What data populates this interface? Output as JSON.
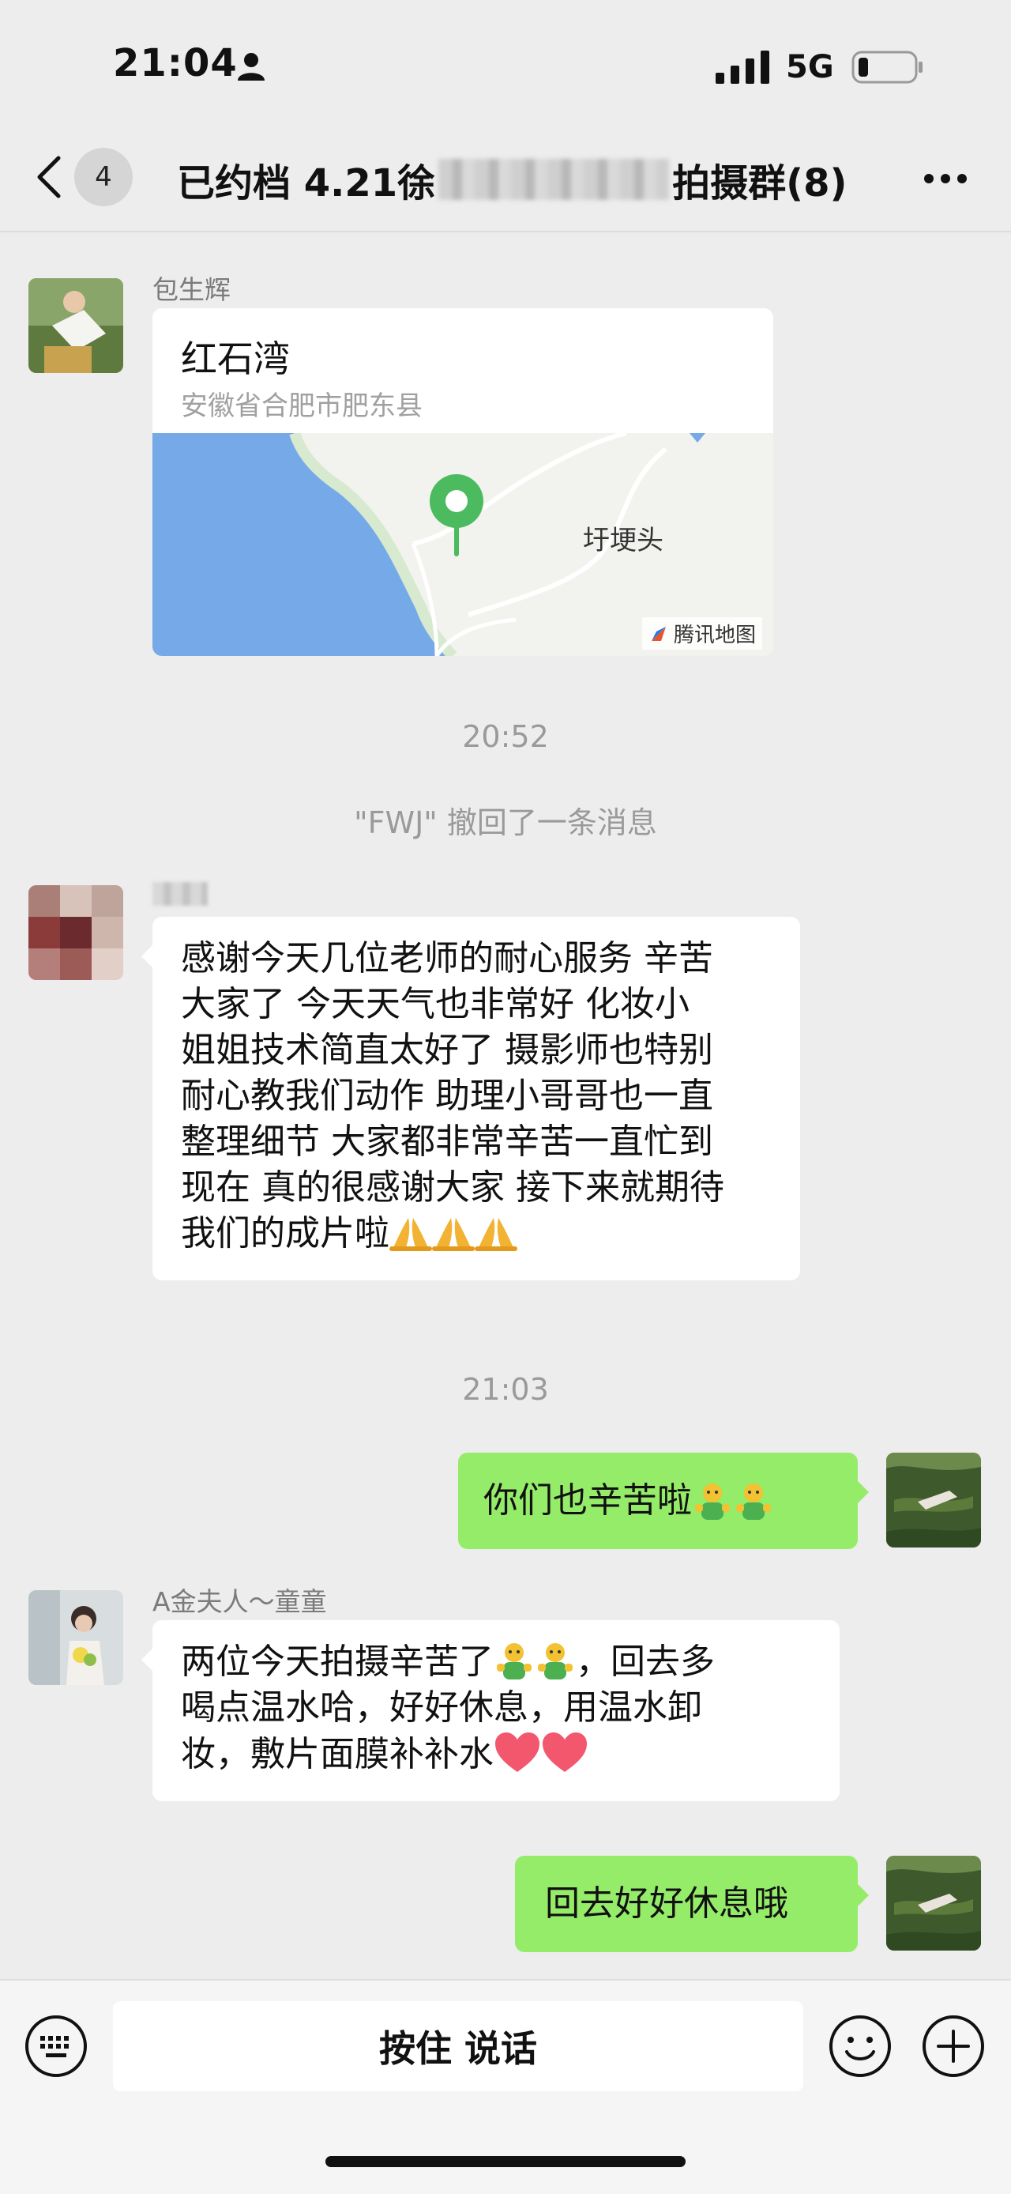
{
  "status": {
    "time": "21:04",
    "network": "5G"
  },
  "nav": {
    "unread_count": "4",
    "title_prefix": "已约档 4.21徐",
    "title_suffix": "拍摄群(8)"
  },
  "messages": {
    "m1": {
      "sender": "包生辉",
      "place": "红石湾",
      "address": "安徽省合肥市肥东县",
      "map_label": "圩埂头",
      "map_brand": "腾讯地图"
    },
    "t1": "20:52",
    "recall": "\"FWJ\" 撤回了一条消息",
    "m2": {
      "lines": [
        "感谢今天几位老师的耐心服务 辛苦",
        "大家了  今天天气也非常好  化妆小",
        "姐姐技术简直太好了 摄影师也特别",
        "耐心教我们动作 助理小哥哥也一直",
        "整理细节 大家都非常辛苦一直忙到",
        "现在  真的很感谢大家 接下来就期待"
      ],
      "last_line": "我们的成片啦"
    },
    "t2": "21:03",
    "m3": {
      "text": "你们也辛苦啦"
    },
    "m4": {
      "sender": "A金夫人～童童",
      "line1a": "两位今天拍摄辛苦了",
      "line1b": "，回去多",
      "line2": "喝点温水哈，好好休息，用温水卸",
      "line3": "妆，敷片面膜补补水"
    },
    "m5": {
      "text": "回去好好休息哦"
    }
  },
  "input": {
    "hold_to_talk": "按住 说话"
  },
  "colors": {
    "bg": "#ededed",
    "my_bubble": "#95ec69",
    "map_water": "#76a9e8",
    "pin": "#4cbb5f"
  }
}
